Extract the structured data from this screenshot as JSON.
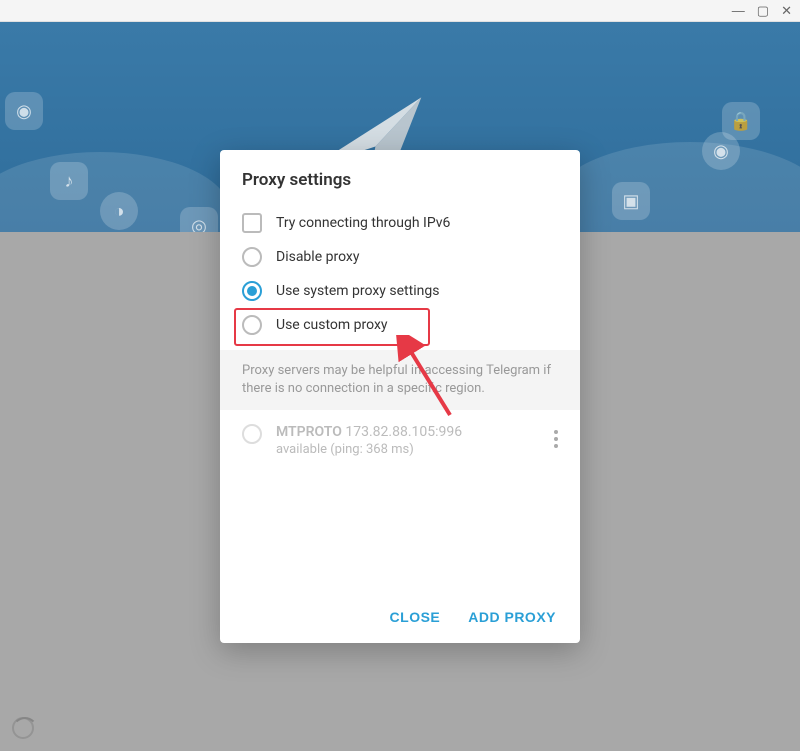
{
  "modal": {
    "title": "Proxy settings",
    "options": {
      "ipv6": "Try connecting through IPv6",
      "disable": "Disable proxy",
      "system": "Use system proxy settings",
      "custom": "Use custom proxy"
    },
    "helper": "Proxy servers may be helpful in accessing Telegram if there is no connection in a specific region.",
    "proxy": {
      "protocol": "MTPROTO",
      "address": "173.82.88.105:996",
      "status": "available (ping: 368 ms)"
    },
    "buttons": {
      "close": "CLOSE",
      "add": "ADD PROXY"
    }
  }
}
